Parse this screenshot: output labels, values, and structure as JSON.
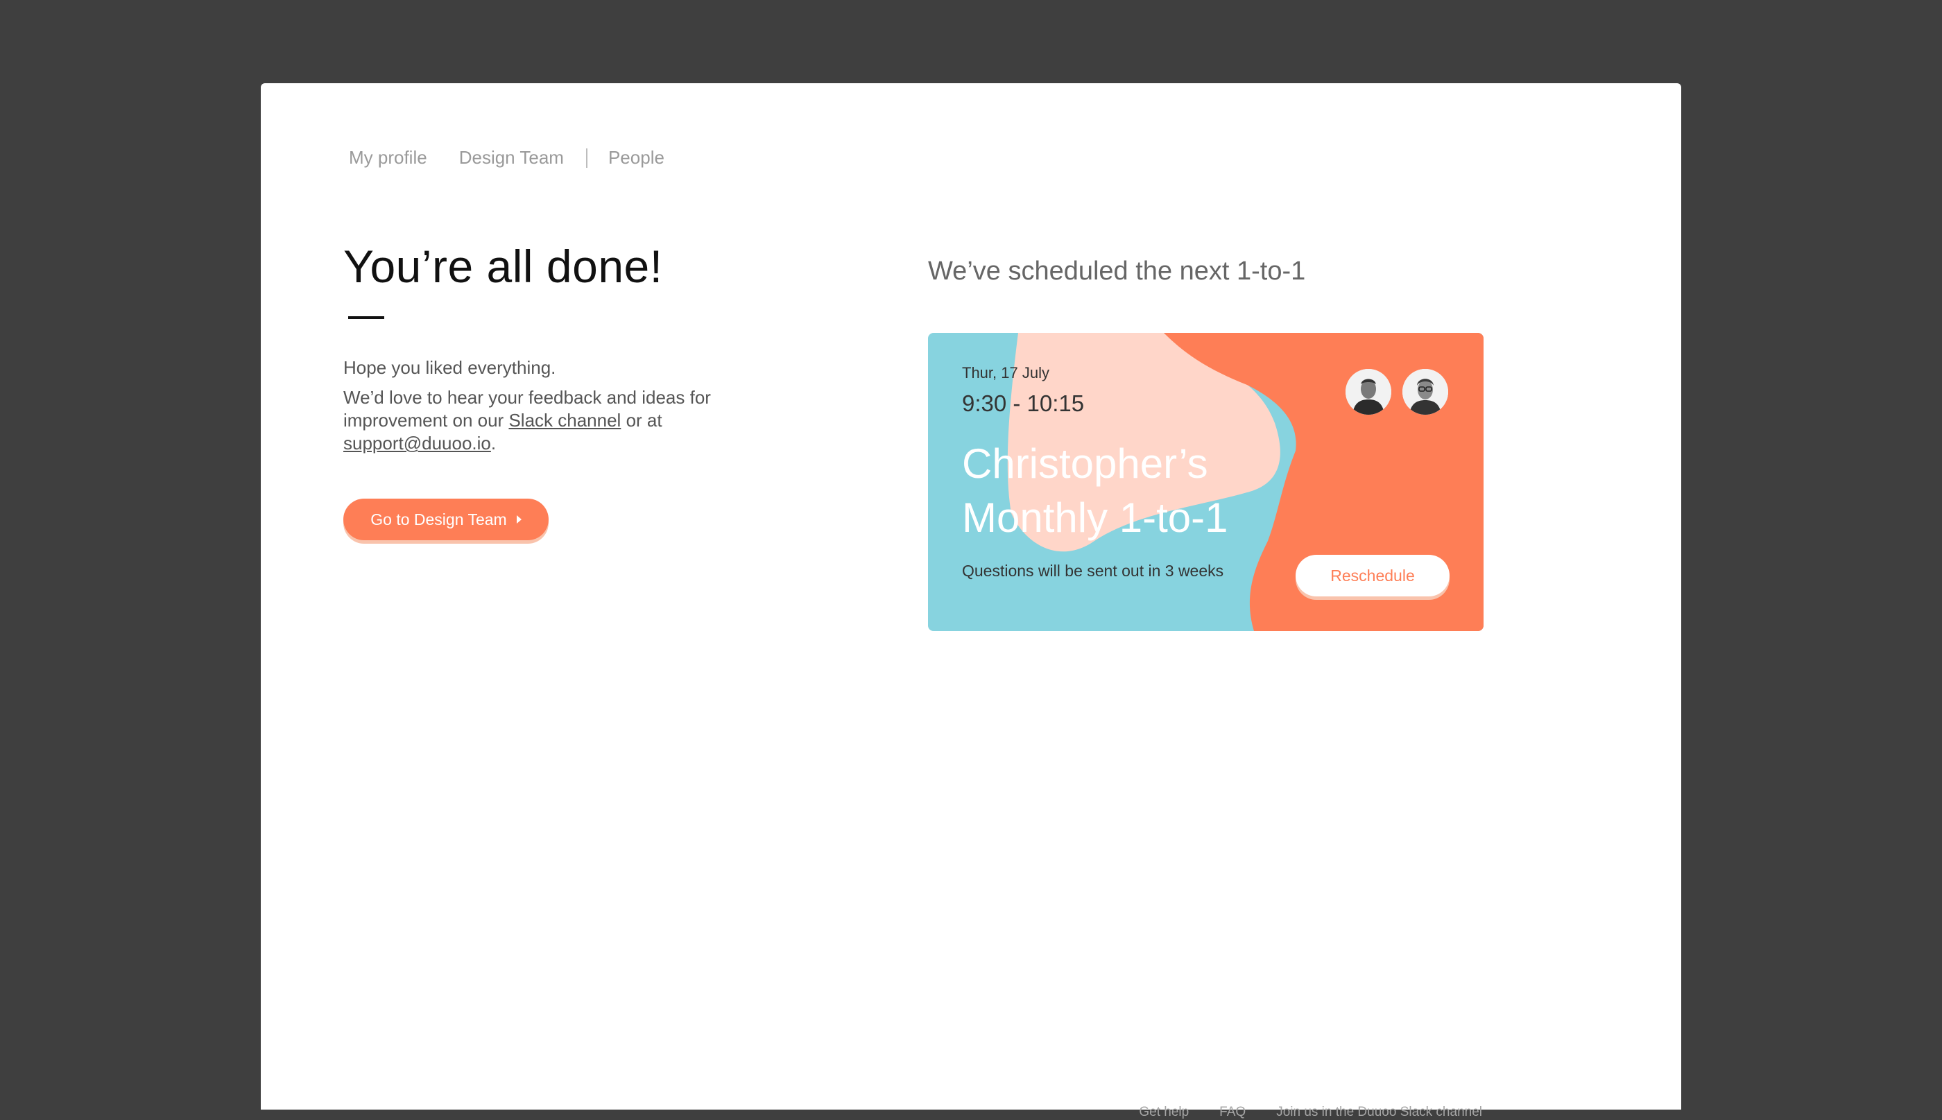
{
  "nav": {
    "items": [
      {
        "label": "My profile"
      },
      {
        "label": "Design Team"
      },
      {
        "label": "People"
      }
    ]
  },
  "main": {
    "headline": "You’re all done!",
    "hope_text": "Hope you liked everything.",
    "feedback_prefix": "We’d love to hear your feedback and ideas for improvement on our ",
    "slack_link": "Slack channel",
    "feedback_middle": " or at ",
    "email_link": "support@duuoo.io",
    "feedback_suffix": ".",
    "go_button_label": "Go to Design Team"
  },
  "schedule": {
    "title": "We’ve scheduled the next 1-to-1",
    "card": {
      "date": "Thur, 17 July",
      "time": "9:30 - 10:15",
      "title_line1": "Christopher’s",
      "title_line2": "Monthly 1-to-1",
      "note": "Questions will be sent out in 3 weeks",
      "reschedule_label": "Reschedule",
      "colors": {
        "blue": "#87d3df",
        "peach": "#ffd6c9",
        "orange": "#fe7e56"
      }
    }
  },
  "footer": {
    "links": [
      {
        "label": "Get help"
      },
      {
        "label": "FAQ"
      },
      {
        "label": "Join us in the Duuoo Slack channel"
      }
    ]
  },
  "colors": {
    "accent": "#fe7e56",
    "backdrop": "#3f3f3f",
    "panel": "#ffffff"
  }
}
